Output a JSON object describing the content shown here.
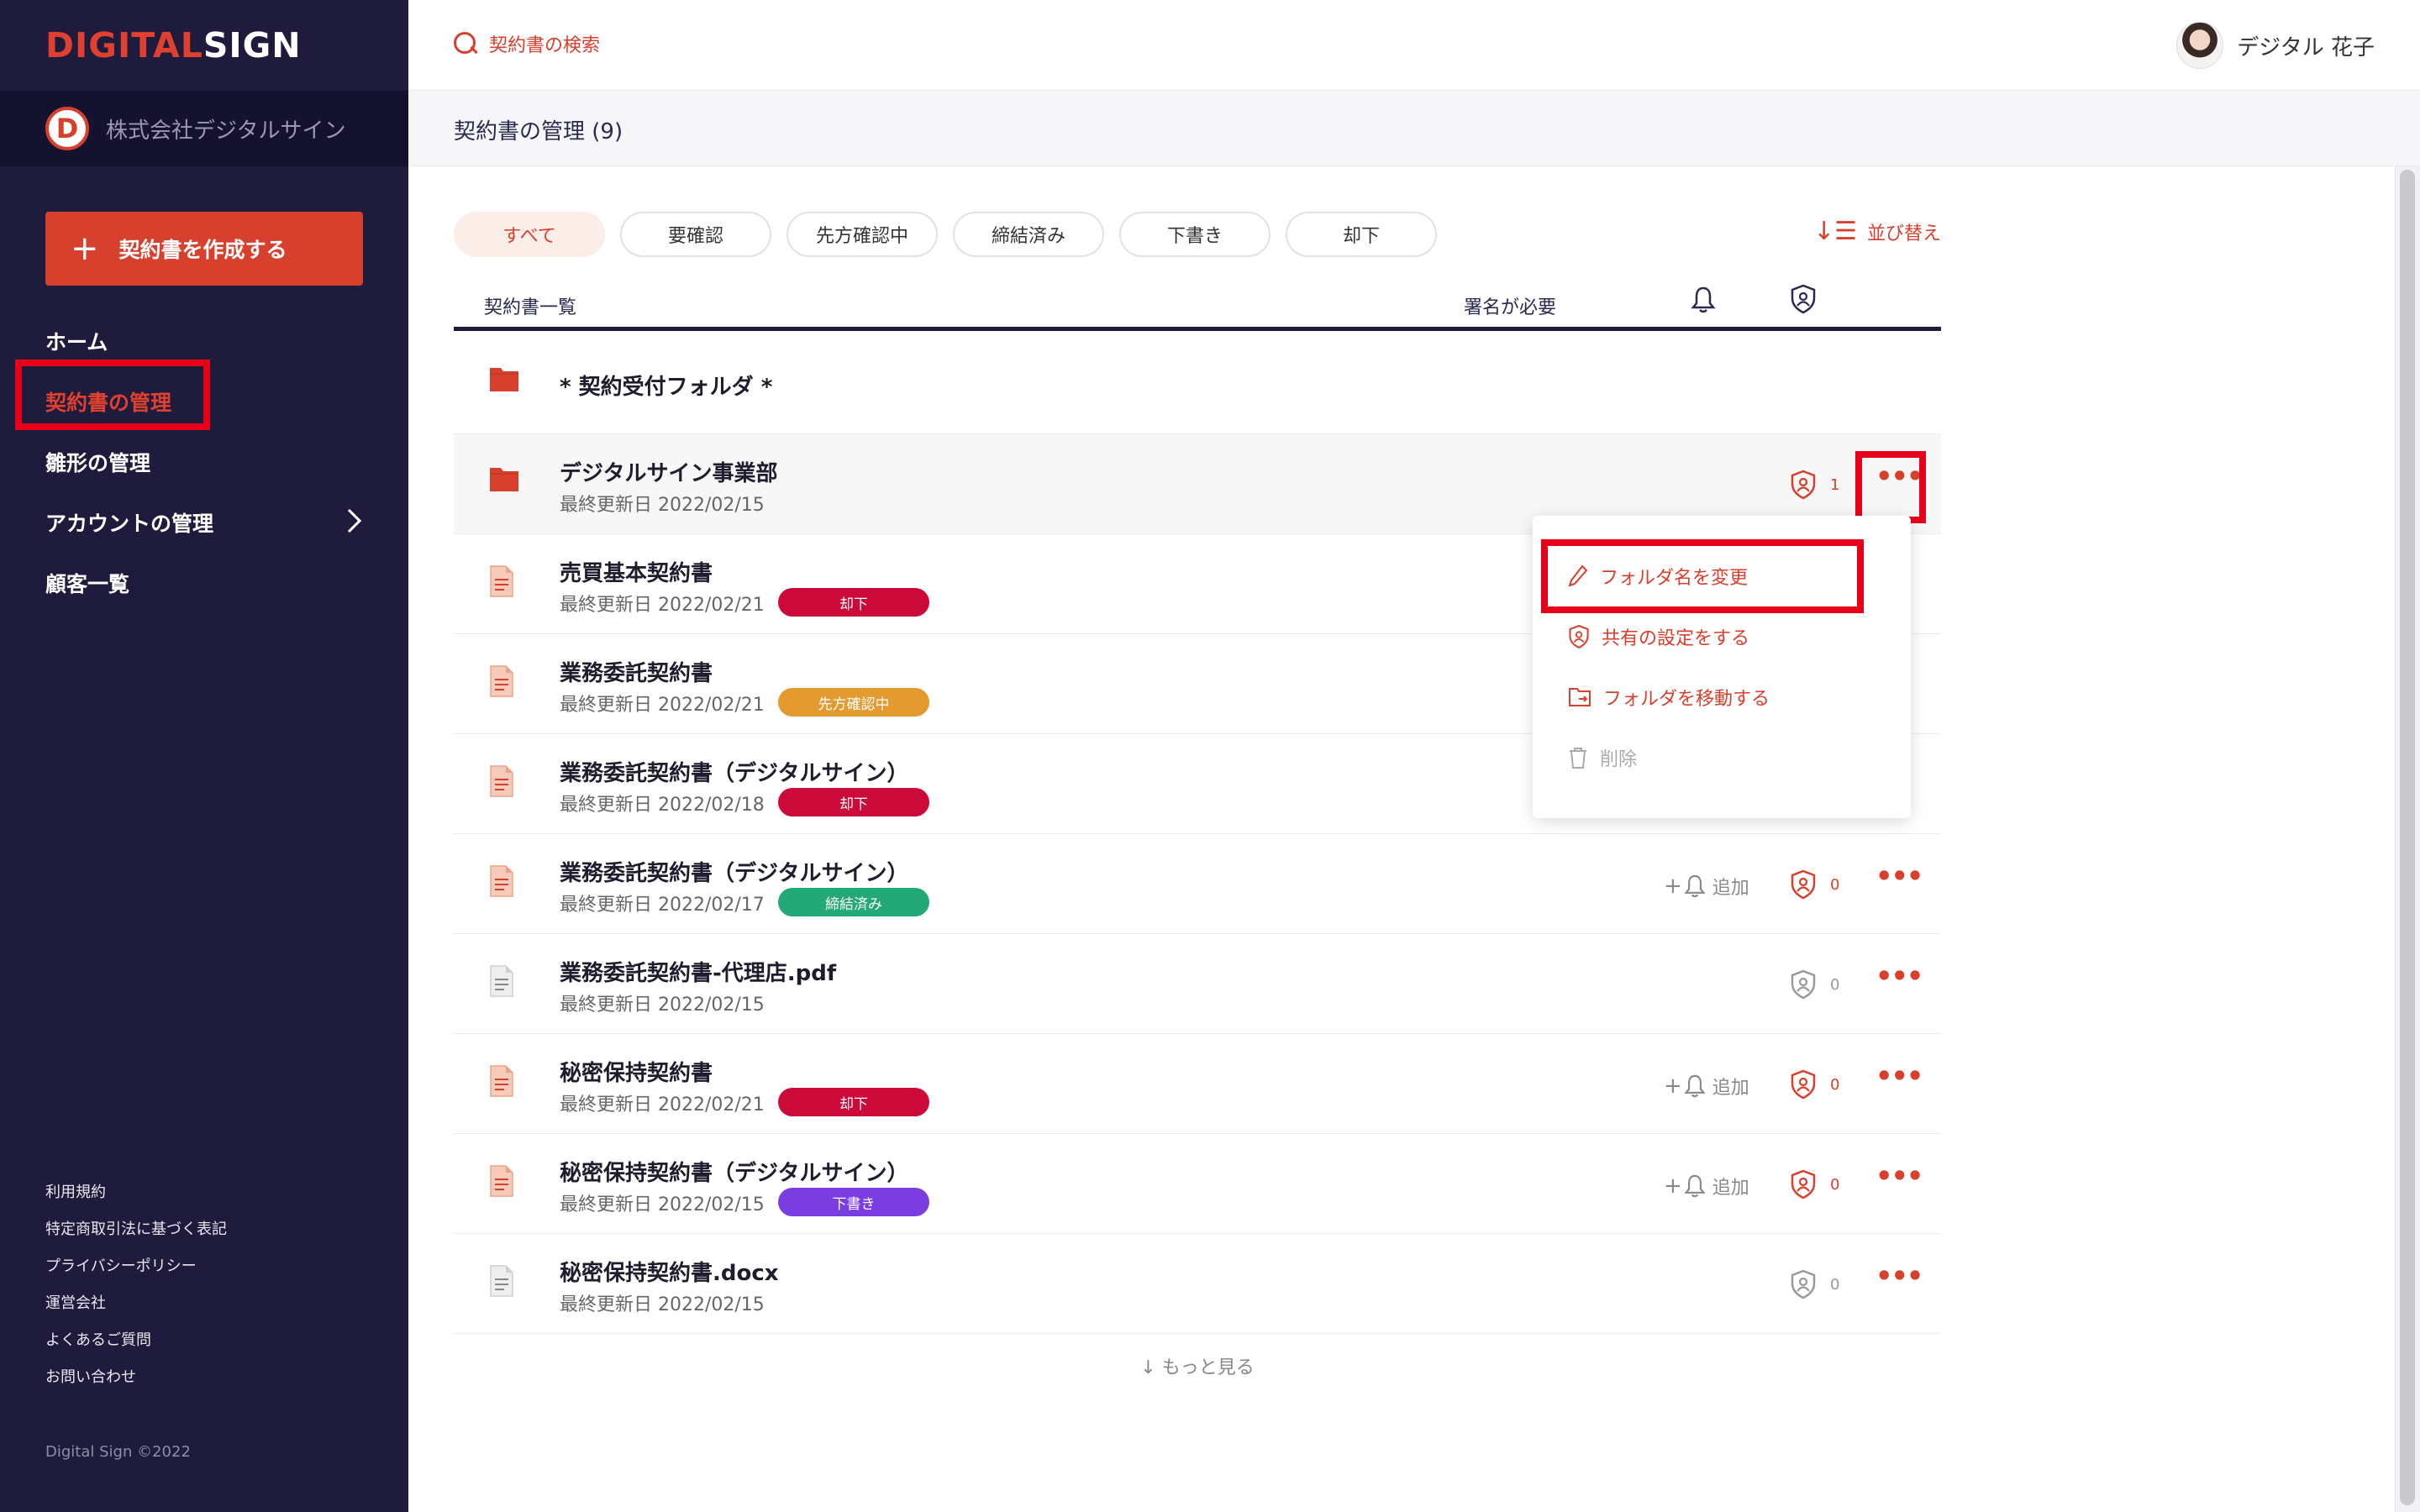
{
  "brand": {
    "logo_part1": "DIGITAL",
    "logo_part2": "SIGN",
    "company_initial": "D",
    "company_name": "株式会社デジタルサイン",
    "accent_color": "#d6402d",
    "sidebar_color": "#1e1b3c"
  },
  "sidebar": {
    "create_button": "契約書を作成する",
    "items": [
      {
        "label": "ホーム"
      },
      {
        "label": "契約書の管理"
      },
      {
        "label": "雛形の管理"
      },
      {
        "label": "アカウントの管理"
      },
      {
        "label": "顧客一覧"
      }
    ],
    "footer_links": [
      "利用規約",
      "特定商取引法に基づく表記",
      "プライバシーポリシー",
      "運営会社",
      "よくあるご質問",
      "お問い合わせ"
    ],
    "copyright": "Digital Sign ©2022"
  },
  "header": {
    "search_placeholder": "契約書の検索",
    "user_name": "デジタル 花子"
  },
  "page": {
    "title": "契約書の管理 (9)"
  },
  "filters": [
    "すべて",
    "要確認",
    "先方確認中",
    "締結済み",
    "下書き",
    "却下"
  ],
  "sort_label": "並び替え",
  "table": {
    "col_list": "契約書一覧",
    "col_sign": "署名が必要"
  },
  "rows": [
    {
      "name": "* 契約受付フォルダ *",
      "date": "",
      "type": "folder",
      "badge": "",
      "add": "",
      "count": ""
    },
    {
      "name": "デジタルサイン事業部",
      "date": "最終更新日 2022/02/15",
      "type": "folder",
      "badge": "",
      "add": "",
      "count": "1"
    },
    {
      "name": "売買基本契約書",
      "date": "最終更新日 2022/02/21",
      "type": "doc",
      "badge": "却下",
      "add": "",
      "count": ""
    },
    {
      "name": "業務委託契約書",
      "date": "最終更新日 2022/02/21",
      "type": "doc",
      "badge": "先方確認中",
      "add": "",
      "count": ""
    },
    {
      "name": "業務委託契約書（デジタルサイン）",
      "date": "最終更新日 2022/02/18",
      "type": "doc",
      "badge": "却下",
      "add": "",
      "count": ""
    },
    {
      "name": "業務委託契約書（デジタルサイン）",
      "date": "最終更新日 2022/02/17",
      "type": "doc",
      "badge": "締結済み",
      "add": "追加",
      "count": "0"
    },
    {
      "name": "業務委託契約書-代理店.pdf",
      "date": "最終更新日 2022/02/15",
      "type": "file",
      "badge": "",
      "add": "",
      "count": "0"
    },
    {
      "name": "秘密保持契約書",
      "date": "最終更新日 2022/02/21",
      "type": "doc",
      "badge": "却下",
      "add": "追加",
      "count": "0"
    },
    {
      "name": "秘密保持契約書（デジタルサイン）",
      "date": "最終更新日 2022/02/15",
      "type": "doc",
      "badge": "下書き",
      "add": "追加",
      "count": "0"
    },
    {
      "name": "秘密保持契約書.docx",
      "date": "最終更新日 2022/02/15",
      "type": "file",
      "badge": "",
      "add": "",
      "count": "0"
    }
  ],
  "badge_colors": {
    "却下": "#cc0a3a",
    "先方確認中": "#e39a2f",
    "締結済み": "#23a977",
    "下書き": "#7a3de0"
  },
  "load_more": "もっと見る",
  "dropdown": {
    "rename": "フォルダ名を変更",
    "share": "共有の設定をする",
    "move": "フォルダを移動する",
    "delete": "削除"
  }
}
